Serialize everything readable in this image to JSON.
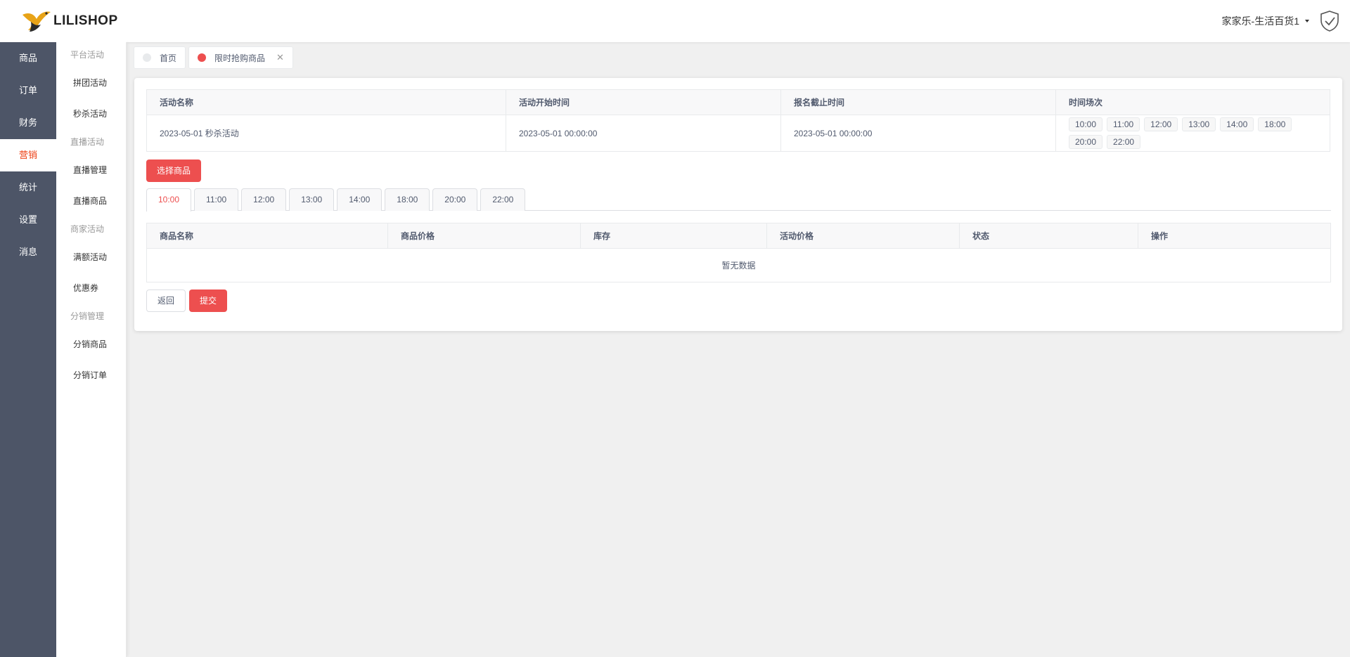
{
  "brand": {
    "name": "LILISHOP"
  },
  "rail": {
    "items": [
      {
        "label": "商品"
      },
      {
        "label": "订单"
      },
      {
        "label": "财务"
      },
      {
        "label": "营销",
        "active": true
      },
      {
        "label": "统计"
      },
      {
        "label": "设置"
      },
      {
        "label": "消息"
      }
    ]
  },
  "submenu": {
    "group1": "平台活动",
    "item_pintuan": "拼团活动",
    "item_miaosha": "秒杀活动",
    "group2": "直播活动",
    "item_live_manage": "直播管理",
    "item_live_goods": "直播商品",
    "group3": "商家活动",
    "item_full_discount": "满额活动",
    "item_coupon": "优惠券",
    "group4": "分销管理",
    "item_dist_goods": "分销商品",
    "item_dist_orders": "分销订单"
  },
  "header": {
    "shop_name": "家家乐-生活百货1"
  },
  "tags": {
    "home": "首页",
    "current": "限时抢购商品"
  },
  "activity_table": {
    "headers": {
      "name": "活动名称",
      "start": "活动开始时间",
      "deadline": "报名截止时间",
      "slots": "时间场次"
    },
    "row": {
      "name": "2023-05-01 秒杀活动",
      "start": "2023-05-01 00:00:00",
      "deadline": "2023-05-01 00:00:00",
      "slots": [
        "10:00",
        "11:00",
        "12:00",
        "13:00",
        "14:00",
        "18:00",
        "20:00",
        "22:00"
      ]
    }
  },
  "choose_button": "选择商品",
  "time_tabs": [
    "10:00",
    "11:00",
    "12:00",
    "13:00",
    "14:00",
    "18:00",
    "20:00",
    "22:00"
  ],
  "goods_table": {
    "headers": {
      "name": "商品名称",
      "price": "商品价格",
      "stock": "库存",
      "activity_price": "活动价格",
      "status": "状态",
      "action": "操作"
    },
    "empty": "暂无数据"
  },
  "buttons": {
    "back": "返回",
    "submit": "提交"
  },
  "colors": {
    "accent": "#ed4f4f",
    "rail": "#4d5567"
  }
}
